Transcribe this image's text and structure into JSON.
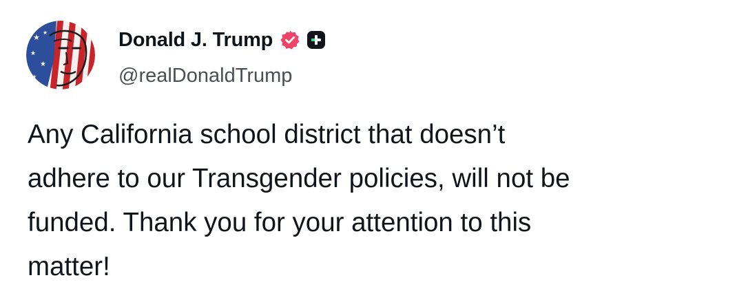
{
  "post": {
    "author": {
      "display_name": "Donald J. Trump",
      "handle": "@realDonaldTrump",
      "avatar_icon": "flag-portrait-avatar",
      "verified_icon": "verified-badge-icon",
      "verified_color": "#f0436a",
      "plus_icon": "plus-badge-icon"
    },
    "text_lines": [
      "Any California school district that doesn’t",
      "adhere to our Transgender policies, will not be",
      "funded. Thank you for your attention to this",
      "matter!"
    ]
  }
}
